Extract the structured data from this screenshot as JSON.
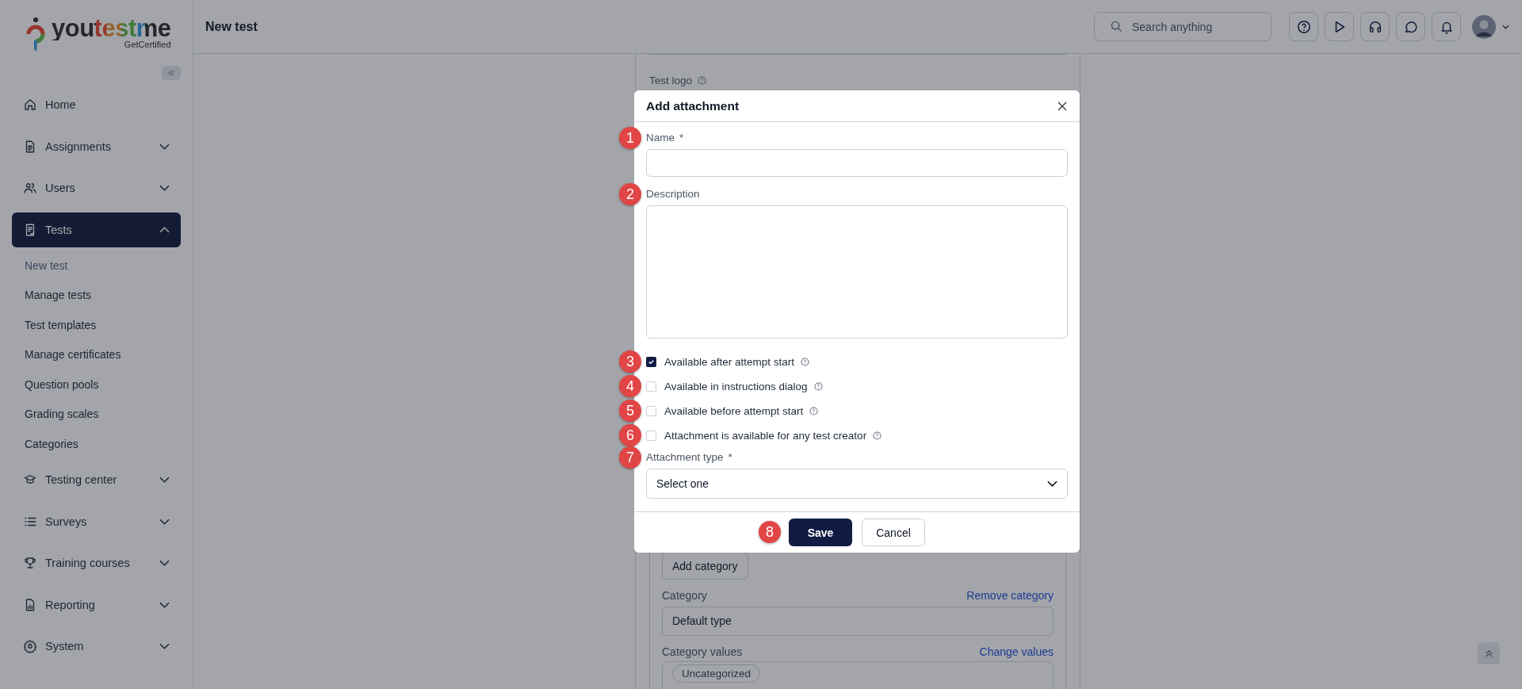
{
  "sidebar": {
    "logo": {
      "name": "youtestme",
      "tagline": "GetCertified"
    },
    "items": [
      {
        "label": "Home",
        "kind": "link",
        "selected": false
      },
      {
        "label": "Assignments",
        "kind": "group",
        "selected": false,
        "expanded": false
      },
      {
        "label": "Users",
        "kind": "group",
        "selected": false,
        "expanded": false
      },
      {
        "label": "Tests",
        "kind": "group",
        "selected": true,
        "expanded": true,
        "children": [
          {
            "label": "New test",
            "selected": true
          },
          {
            "label": "Manage tests",
            "selected": false
          },
          {
            "label": "Test templates",
            "selected": false
          },
          {
            "label": "Manage certificates",
            "selected": false
          },
          {
            "label": "Question pools",
            "selected": false
          },
          {
            "label": "Grading scales",
            "selected": false
          },
          {
            "label": "Categories",
            "selected": false
          }
        ]
      },
      {
        "label": "Testing center",
        "kind": "group",
        "selected": false,
        "expanded": false
      },
      {
        "label": "Surveys",
        "kind": "group",
        "selected": false,
        "expanded": false
      },
      {
        "label": "Training courses",
        "kind": "group",
        "selected": false,
        "expanded": false
      },
      {
        "label": "Reporting",
        "kind": "group",
        "selected": false,
        "expanded": false
      },
      {
        "label": "System",
        "kind": "group",
        "selected": false,
        "expanded": false
      }
    ]
  },
  "header": {
    "title": "New test",
    "search": {
      "placeholder": "Search anything"
    }
  },
  "page": {
    "test_logo_label": "Test logo",
    "add_category_button": "Add category",
    "category": {
      "label": "Category",
      "link": "Remove category",
      "value": "Default type"
    },
    "category_values": {
      "label": "Category values",
      "link": "Change values",
      "chips": [
        "Uncategorized"
      ]
    }
  },
  "dialog": {
    "title": "Add attachment",
    "fields": [
      {
        "kind": "text",
        "label": "Name",
        "required_mark": "*",
        "marker": "1"
      },
      {
        "kind": "textarea",
        "label": "Description",
        "marker": "2"
      },
      {
        "kind": "checkbox",
        "label": "Available after attempt start",
        "checked": true,
        "marker": "3"
      },
      {
        "kind": "checkbox",
        "label": "Available in instructions dialog",
        "checked": false,
        "marker": "4"
      },
      {
        "kind": "checkbox",
        "label": "Available before attempt start",
        "checked": false,
        "marker": "5"
      },
      {
        "kind": "checkbox",
        "label": "Attachment is available for any test creator",
        "checked": false,
        "marker": "6"
      },
      {
        "kind": "select",
        "label": "Attachment type",
        "required_mark": "*",
        "value": "Select one",
        "marker": "7"
      }
    ],
    "buttons": [
      {
        "label": "Save",
        "kind": "primary",
        "marker": "8"
      },
      {
        "label": "Cancel",
        "kind": "secondary"
      }
    ]
  }
}
